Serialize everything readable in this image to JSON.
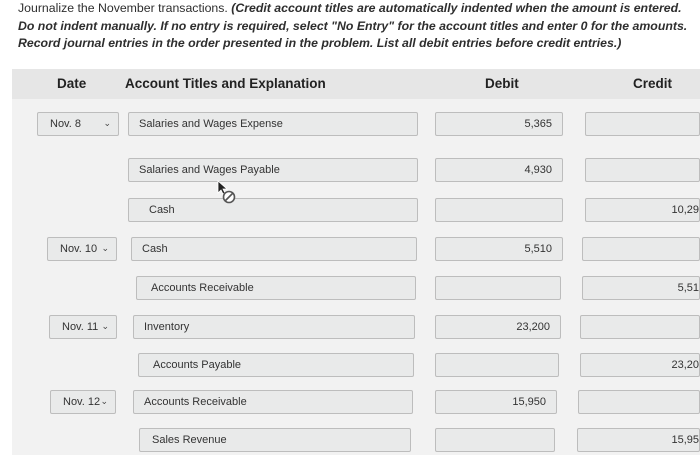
{
  "instructions": {
    "lead": "Journalize the November transactions. ",
    "emphasis": "(Credit account titles are automatically indented when the amount is entered. Do not indent manually.",
    "body": " If no entry is required, select \"No Entry\" for the account titles and enter 0 for the amounts. Record journal entries in the order presented in the problem. List all debit entries before credit entries.)"
  },
  "headers": {
    "date": "Date",
    "account": "Account Titles and Explanation",
    "debit": "Debit",
    "credit": "Credit"
  },
  "rows": [
    {
      "date": "Nov. 8",
      "account": "Salaries and Wages Expense",
      "debit": "5,365",
      "credit": ""
    },
    {
      "date": "",
      "account": "Salaries and Wages Payable",
      "debit": "4,930",
      "credit": ""
    },
    {
      "date": "",
      "account": "Cash",
      "debit": "",
      "credit": "10,29"
    },
    {
      "date": "Nov. 10",
      "account": "Cash",
      "debit": "5,510",
      "credit": ""
    },
    {
      "date": "",
      "account": "Accounts Receivable",
      "debit": "",
      "credit": "5,51"
    },
    {
      "date": "Nov. 11",
      "account": "Inventory",
      "debit": "23,200",
      "credit": ""
    },
    {
      "date": "",
      "account": "Accounts Payable",
      "debit": "",
      "credit": "23,20"
    },
    {
      "date": "Nov. 12",
      "account": "Accounts Receivable",
      "debit": "15,950",
      "credit": ""
    },
    {
      "date": "",
      "account": "Sales Revenue",
      "debit": "",
      "credit": "15,95"
    }
  ],
  "icons": {
    "date_dropdown": "chevron-down-icon",
    "pointer": "cursor-arrow-not-allowed-icon"
  }
}
